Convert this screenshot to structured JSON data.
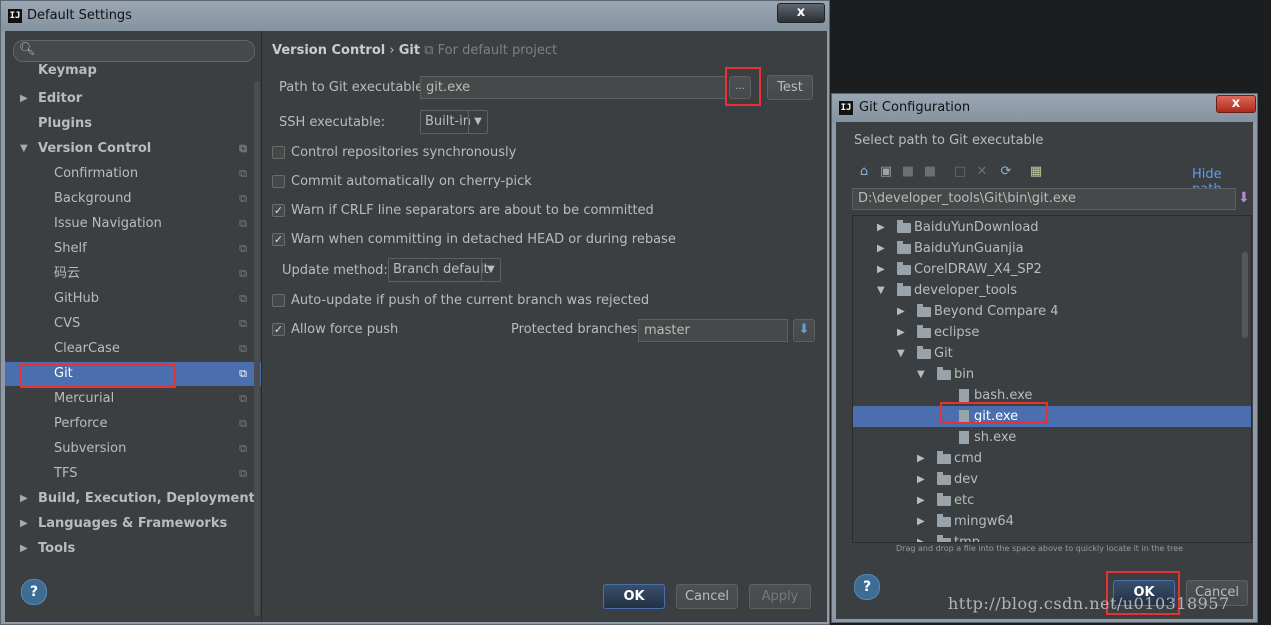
{
  "settings_window": {
    "title": "Default Settings",
    "close_label": "x",
    "sidebar": {
      "items": [
        {
          "label": "Keymap"
        },
        {
          "label": "Editor"
        },
        {
          "label": "Plugins"
        },
        {
          "label": "Version Control"
        },
        {
          "label": "Confirmation"
        },
        {
          "label": "Background"
        },
        {
          "label": "Issue Navigation"
        },
        {
          "label": "Shelf"
        },
        {
          "label": "码云"
        },
        {
          "label": "GitHub"
        },
        {
          "label": "CVS"
        },
        {
          "label": "ClearCase"
        },
        {
          "label": "Git"
        },
        {
          "label": "Mercurial"
        },
        {
          "label": "Perforce"
        },
        {
          "label": "Subversion"
        },
        {
          "label": "TFS"
        },
        {
          "label": "Build, Execution, Deployment"
        },
        {
          "label": "Languages & Frameworks"
        },
        {
          "label": "Tools"
        }
      ]
    },
    "breadcrumb": {
      "part1": "Version Control",
      "sep": "›",
      "part2": "Git",
      "note": "For default project"
    },
    "path_label": "Path to Git executable:",
    "path_value": "git.exe",
    "browse_label": "...",
    "test_label": "Test",
    "ssh_label": "SSH executable:",
    "ssh_value": "Built-in",
    "checkboxes": [
      {
        "label": "Control repositories synchronously",
        "checked": false
      },
      {
        "label": "Commit automatically on cherry-pick",
        "checked": false
      },
      {
        "label": "Warn if CRLF line separators are about to be committed",
        "checked": true
      },
      {
        "label": "Warn when committing in detached HEAD or during rebase",
        "checked": true
      }
    ],
    "update_method_label": "Update method:",
    "update_method_value": "Branch default",
    "auto_update_label": "Auto-update if push of the current branch was rejected",
    "force_push_label": "Allow force push",
    "protected_label": "Protected branches:",
    "protected_value": "master",
    "help_label": "?",
    "ok_label": "OK",
    "cancel_label": "Cancel",
    "apply_label": "Apply"
  },
  "git_window": {
    "title": "Git Configuration",
    "close_label": "x",
    "prompt": "Select path to Git executable",
    "hide_path_label": "Hide path",
    "path_value": "D:\\developer_tools\\Git\\bin\\git.exe",
    "tree": [
      {
        "label": "BaiduYunDownload",
        "type": "folder",
        "expanded": false
      },
      {
        "label": "BaiduYunGuanjia",
        "type": "folder",
        "expanded": false
      },
      {
        "label": "CorelDRAW_X4_SP2",
        "type": "folder",
        "expanded": false
      },
      {
        "label": "developer_tools",
        "type": "folder",
        "expanded": true
      },
      {
        "label": "Beyond Compare 4",
        "type": "folder",
        "expanded": false
      },
      {
        "label": "eclipse",
        "type": "folder",
        "expanded": false
      },
      {
        "label": "Git",
        "type": "folder",
        "expanded": true
      },
      {
        "label": "bin",
        "type": "folder",
        "expanded": true
      },
      {
        "label": "bash.exe",
        "type": "file"
      },
      {
        "label": "git.exe",
        "type": "file",
        "selected": true
      },
      {
        "label": "sh.exe",
        "type": "file"
      },
      {
        "label": "cmd",
        "type": "folder",
        "expanded": false
      },
      {
        "label": "dev",
        "type": "folder",
        "expanded": false
      },
      {
        "label": "etc",
        "type": "folder",
        "expanded": false
      },
      {
        "label": "mingw64",
        "type": "folder",
        "expanded": false
      },
      {
        "label": "tmp",
        "type": "folder",
        "expanded": false
      }
    ],
    "hint": "Drag and drop a file into the space above to quickly locate it in the tree",
    "help_label": "?",
    "ok_label": "OK",
    "cancel_label": "Cancel"
  },
  "watermark": "http://blog.csdn.net/u010318957",
  "colors": {
    "selection": "#4b6eaf",
    "highlight_box": "#e53333",
    "panel_bg": "#3c3f41"
  }
}
